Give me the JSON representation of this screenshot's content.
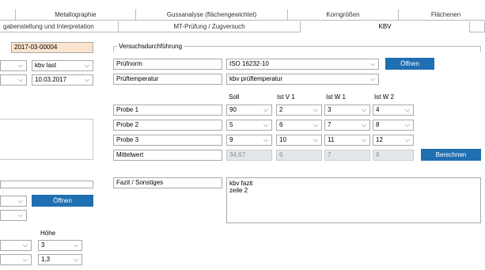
{
  "tabs_row1": [
    "Metallographie",
    "Gussanalyse (flächengewichtet)",
    "Korngrößen",
    "Flächenen"
  ],
  "tabs_row2": [
    "gabenstellung und Interpretation",
    "MT-Prüfung / Zugversuch",
    "KBV",
    ""
  ],
  "left": {
    "id_value": "2017-03-00004",
    "combo1": "",
    "combo2": "kbv last",
    "combo3": "",
    "date": "10.03.2017",
    "oeffnen_label": "Öffnen",
    "hoehe_label": "Höhe",
    "hoehe_values": [
      "3",
      "1,3"
    ]
  },
  "group_title": "Versuchsdurchführung",
  "form": {
    "pruefnorm_label": "Prüfnorm",
    "pruefnorm_value": "ISO 16232-10",
    "oeffnen_label": "Öffnen",
    "pruef_temp_label": "Prüftemperatur",
    "pruef_temp_value": "kbv prüftemperatur"
  },
  "grid": {
    "headers": [
      "Soll",
      "Ist V 1",
      "Ist W 1",
      "Ist W 2"
    ],
    "rows": [
      {
        "label": "Probe 1",
        "values": [
          "90",
          "2",
          "3",
          "4"
        ]
      },
      {
        "label": "Probe 2",
        "values": [
          "5",
          "6",
          "7",
          "8"
        ]
      },
      {
        "label": "Probe 3",
        "values": [
          "9",
          "10",
          "11",
          "12"
        ]
      }
    ],
    "mittelwert_label": "Mittelwert",
    "mittelwert_values": [
      "34,67",
      "6",
      "7",
      "8"
    ],
    "berechnen_label": "Berechnen"
  },
  "fazit": {
    "label": "Fazit / Sonstiges",
    "line1": "kbv fazit",
    "line2": "zeile 2"
  },
  "icons": {
    "dropdown": "chevron-down-icon"
  },
  "colors": {
    "button_bg": "#1f6fb2",
    "id_highlight": "#fbe3cd"
  }
}
